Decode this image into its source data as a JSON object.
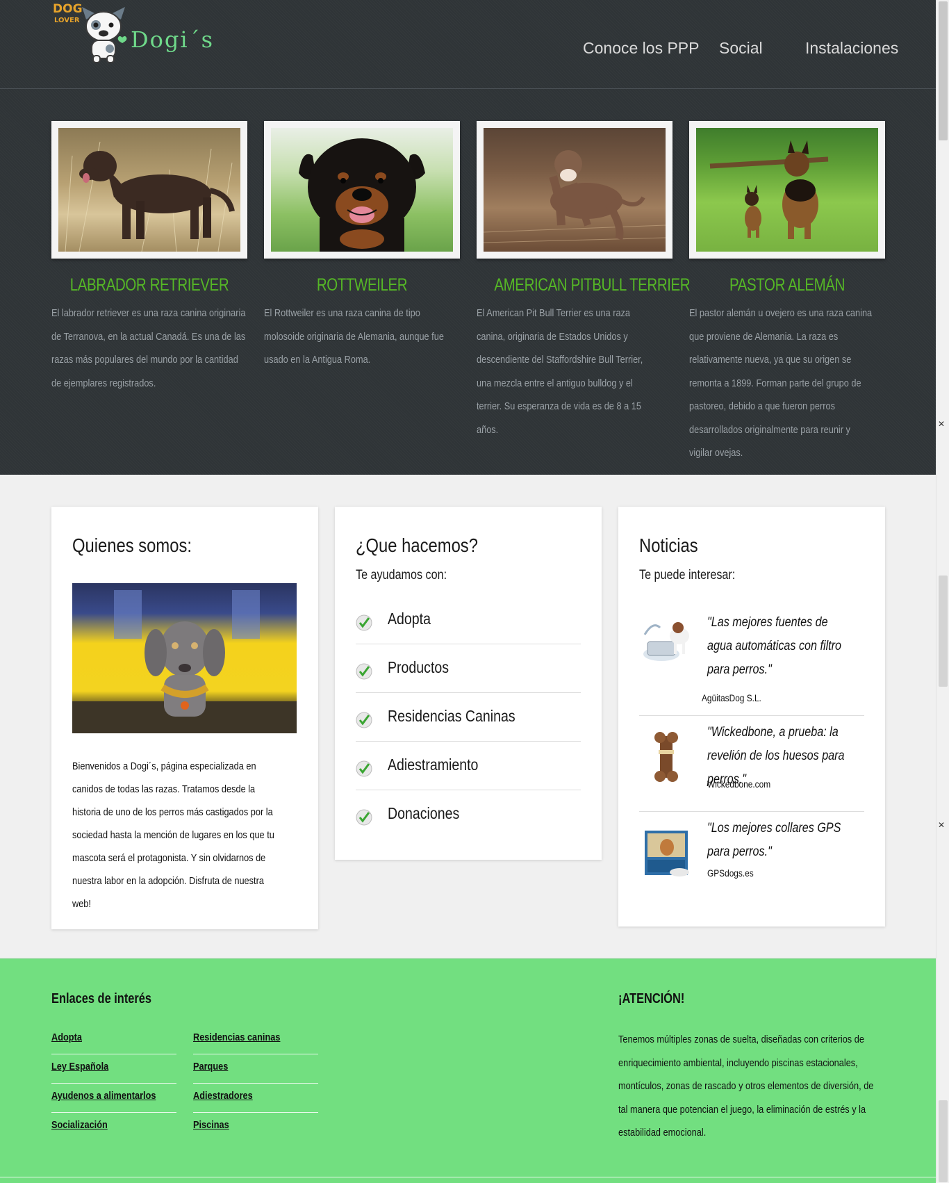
{
  "header": {
    "logo": {
      "badge_top": "DOG",
      "badge_bottom": "LOVER",
      "name": "Dogi´s"
    },
    "nav": [
      {
        "label": "Conoce los PPP"
      },
      {
        "label": "Social"
      },
      {
        "label": "Instalaciones"
      }
    ]
  },
  "breeds": [
    {
      "title": "LABRADOR RETRIEVER",
      "description": "El labrador retriever es una raza canina originaria de Terranova, en la actual Canadá. Es una de las razas más populares del mundo por la cantidad de ejemplares registrados.",
      "photo": "brown-labrador-in-dry-grass"
    },
    {
      "title": "ROTTWEILER",
      "description": "El Rottweiler es una raza canina de tipo molosoide originaria de Alemania, aunque fue usado en la Antigua Roma.",
      "photo": "rottweiler-portrait"
    },
    {
      "title": "AMERICAN PITBULL TERRIER",
      "description": "El American Pit Bull Terrier es una raza canina, originaria de Estados Unidos y descendiente del Staffordshire Bull Terrier, una mezcla entre el antiguo bulldog y el terrier. Su esperanza de vida es de 8 a 15 años.",
      "photo": "pitbull-running-in-field"
    },
    {
      "title": "PASTOR ALEMÁN",
      "description": "El pastor alemán u ovejero es una raza canina que proviene de Alemania. La raza es relativamente nueva, ya que su origen se remonta a 1899. Forman parte del grupo de pastoreo, debido a que fueron perros desarrollados originalmente para reunir y vigilar ovejas.",
      "photo": "german-shepherds-with-stick"
    }
  ],
  "about": {
    "title": "Quienes somos:",
    "photo": "weimaraner-in-front-of-yellow-train",
    "text": "Bienvenidos a Dogi´s, página especializada en canidos de todas las razas. Tratamos desde la historia de uno de los perros más castigados por la sociedad hasta la mención de lugares en los que tu mascota será el protagonista. Y sin olvidarnos de nuestra labor en la adopción. Disfruta de nuestra web!"
  },
  "services": {
    "title": "¿Que hacemos?",
    "subtitle": "Te ayudamos con:",
    "items": [
      {
        "label": "Adopta"
      },
      {
        "label": "Productos"
      },
      {
        "label": "Residencias Caninas"
      },
      {
        "label": "Adiestramiento"
      },
      {
        "label": "Donaciones"
      }
    ]
  },
  "news": {
    "title": "Noticias",
    "subtitle": "Te puede interesar:",
    "items": [
      {
        "quote": "\"Las mejores fuentes de agua automáticas con filtro para perros.\"",
        "source": "AgüitasDog S.L.",
        "image": "water-fountain"
      },
      {
        "quote": "\"Wickedbone, a prueba: la revelión de los huesos para perros.\"",
        "source": "Wickedbone.com",
        "image": "dog-bone"
      },
      {
        "quote": "\"Los mejores collares GPS para perros.\"",
        "source": "GPSdogs.es",
        "image": "gps-collar-box"
      }
    ]
  },
  "footer": {
    "links_title": "Enlaces de interés",
    "links_col1": [
      "Adopta",
      "Ley Española",
      "Ayudenos a alimentarlos",
      "Socialización"
    ],
    "links_col2": [
      "Residencias caninas",
      "Parques",
      "Adiestradores",
      "Piscinas"
    ],
    "notice_title": "¡ATENCIÓN!",
    "notice_text": "Tenemos múltiples zonas de suelta, diseñadas con criterios de enriquecimiento ambiental, incluyendo piscinas estacionales, montículos, zonas de rascado y otros elementos de diversión, de tal manera que potencian el juego, la eliminación de estrés y la estabilidad emocional."
  },
  "colors": {
    "header_bg": "#2f3437",
    "breed_title": "#55b726",
    "footer_bg": "#72df80",
    "logo_name": "#6fd98a",
    "logo_badge": "#e6a32b"
  }
}
